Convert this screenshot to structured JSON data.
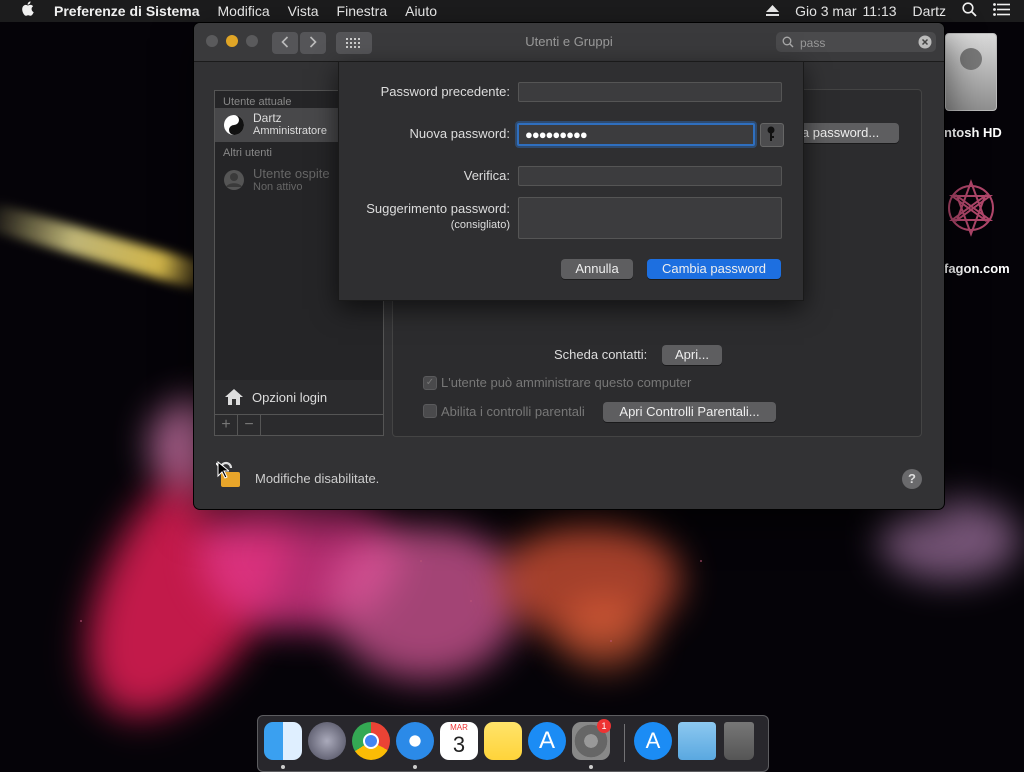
{
  "menubar": {
    "apple": "",
    "app_name": "Preferenze di Sistema",
    "menus": [
      "Modifica",
      "Vista",
      "Finestra",
      "Aiuto"
    ],
    "date": "Gio 3 mar",
    "time": "11:13",
    "user": "Dartz"
  },
  "desktop": {
    "disk_label": "ntosh HD",
    "site_label": "fagon.com"
  },
  "window": {
    "title": "Utenti e Gruppi",
    "search_value": "pass",
    "sidebar": {
      "current_header": "Utente attuale",
      "current_user": {
        "name": "Dartz",
        "role": "Amministratore"
      },
      "others_header": "Altri utenti",
      "other_user": {
        "name": "Utente ospite",
        "status": "Non attivo"
      },
      "login_options": "Opzioni login"
    },
    "panel": {
      "change_password_partial": "ia password...",
      "contact_card_label": "Scheda contatti:",
      "open_button": "Apri...",
      "admin_checkbox_label": "L'utente può amministrare questo computer",
      "parental_checkbox_label": "Abilita i controlli parentali",
      "parental_button": "Apri Controlli Parentali..."
    },
    "lock_text": "Modifiche disabilitate.",
    "help": "?"
  },
  "sheet": {
    "old_password_label": "Password precedente:",
    "new_password_label": "Nuova password:",
    "new_password_value": "●●●●●●●●●",
    "verify_label": "Verifica:",
    "hint_label": "Suggerimento password:",
    "hint_sub_label": "(consigliato)",
    "cancel_button": "Annulla",
    "confirm_button": "Cambia password"
  },
  "dock": {
    "calendar_month": "MAR",
    "calendar_day": "3",
    "prefs_badge": "1"
  }
}
